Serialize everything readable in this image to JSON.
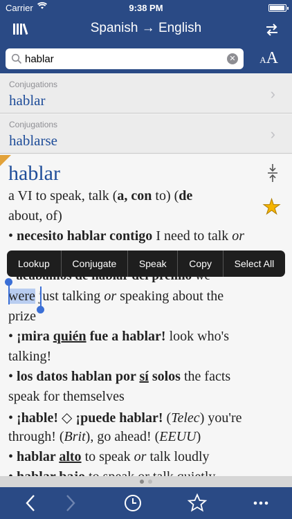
{
  "status": {
    "carrier": "Carrier",
    "time": "9:38 PM"
  },
  "nav": {
    "title": "Spanish → English"
  },
  "search": {
    "value": "hablar",
    "placeholder": ""
  },
  "fontsize": {
    "small": "A",
    "large": "A"
  },
  "results": [
    {
      "subtitle": "Conjugations",
      "word": "hablar"
    },
    {
      "subtitle": "Conjugations",
      "word": "hablarse"
    }
  ],
  "entry": {
    "headword": "hablar",
    "pos_mark": "a",
    "pos": "VI",
    "def1": " to speak, talk (",
    "def1_b": "a, con",
    "def1_c": " to) (",
    "def1_d": "de",
    "def2": "about, of)",
    "ex1_b": "necesito hablar contigo",
    "ex1_t": " I need to talk ",
    "ex1_i": "or",
    "ex2_b": "acabamos de hablar del premio",
    "ex2_t": " we",
    "ex3_sel": "were",
    "ex3_t": " just talking ",
    "ex3_i": "or",
    "ex3_t2": " speaking about the",
    "ex4": "prize",
    "ex5_b": "¡mira ",
    "ex5_u": "quién",
    "ex5_b2": " fue a hablar!",
    "ex5_t": " look who's",
    "ex6": "talking!",
    "ex7_b": "los datos hablan por ",
    "ex7_u": "sí",
    "ex7_b2": " solos",
    "ex7_t": " the facts",
    "ex8": "speak for themselves",
    "ex9_b": "¡hable!",
    "ex9_d": " ◇ ",
    "ex9_b2": "¡puede hablar!",
    "ex9_t": " (",
    "ex9_i": "Telec",
    "ex9_t2": ") you're",
    "ex10_t": "through! (",
    "ex10_i": "Brit",
    "ex10_t2": "), go ahead! (",
    "ex10_i2": "EEUU",
    "ex10_t3": ")",
    "ex11_b": "hablar ",
    "ex11_u": "alto",
    "ex11_t": " to speak ",
    "ex11_i": "or",
    "ex11_t2": " talk loudly",
    "ex12_b": "hablar bajo",
    "ex12_t": " to speak or talk quietly"
  },
  "menu": [
    "Lookup",
    "Conjugate",
    "Speak",
    "Copy",
    "Select All"
  ],
  "colors": {
    "brand": "#2a4a85",
    "link": "#1f4d99",
    "star": "#f5b400"
  }
}
